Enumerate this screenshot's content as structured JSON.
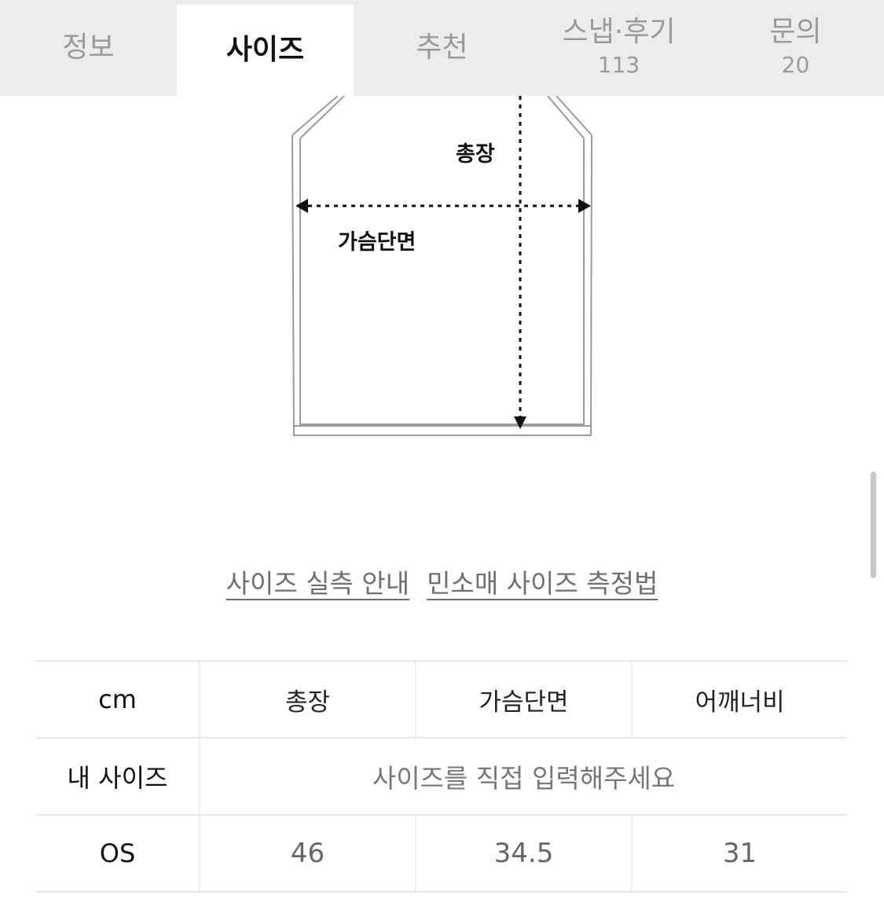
{
  "tabs": [
    {
      "label": "정보",
      "count": null,
      "active": false
    },
    {
      "label": "사이즈",
      "count": null,
      "active": true
    },
    {
      "label": "추천",
      "count": null,
      "active": false
    },
    {
      "label": "스냅·후기",
      "count": "113",
      "active": false
    },
    {
      "label": "문의",
      "count": "20",
      "active": false
    }
  ],
  "diagram": {
    "total_length_label": "총장",
    "chest_width_label": "가슴단면"
  },
  "links": {
    "size_guide": "사이즈 실측 안내",
    "sleeveless_measure": "민소매 사이즈 측정법"
  },
  "size_table": {
    "unit": "cm",
    "columns": [
      "총장",
      "가슴단면",
      "어깨너비"
    ],
    "my_size_label": "내 사이즈",
    "my_size_prompt": "사이즈를 직접 입력해주세요",
    "rows": [
      {
        "size": "OS",
        "values": [
          "46",
          "34.5",
          "31"
        ]
      }
    ]
  }
}
